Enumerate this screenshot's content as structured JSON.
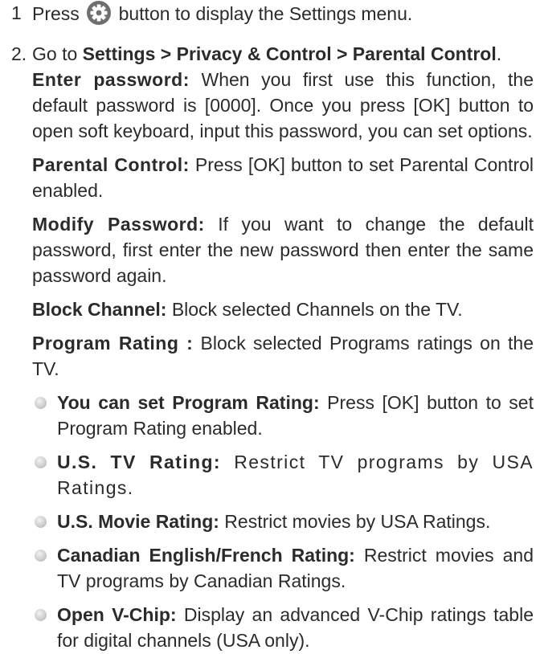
{
  "step1": {
    "number": "1",
    "pre": "Press",
    "icon": "settings-gear-icon",
    "post": "button to display the Settings menu."
  },
  "step2": {
    "number": "2.",
    "goto_pre": "Go to",
    "goto_path": "Settings > Privacy & Control > Parental Control",
    "goto_end": ".",
    "items": [
      {
        "label": "Enter password:",
        "text": "When you first use this function, the default password is [0000]. Once you press [OK] button to open soft keyboard, input this password, you can set options."
      },
      {
        "label": "Parental Control:",
        "text": "Press [OK] button to set Parental Control enabled."
      },
      {
        "label": "Modify Password:",
        "text": "If you want to change the default password, first enter the new password then enter the same password again."
      },
      {
        "label": "Block Channel:",
        "text": "Block selected Channels on the TV."
      },
      {
        "label": "Program Rating :",
        "text": "Block selected Programs ratings on the TV."
      }
    ],
    "bullets": [
      {
        "label": "You can set Program Rating:",
        "text": "Press [OK] button to set Program Rating enabled."
      },
      {
        "label": "U.S. TV Rating:",
        "text": "Restrict TV programs by USA Ratings."
      },
      {
        "label": "U.S. Movie Rating:",
        "text": "Restrict movies by USA Ratings."
      },
      {
        "label": "Canadian English/French Rating:",
        "text": "Restrict movies and TV programs by Canadian Ratings."
      },
      {
        "label": "Open V-Chip:",
        "text": "Display an advanced V-Chip ratings table for digital channels (USA only)."
      }
    ]
  },
  "colors": {
    "text": "#2b2b2b",
    "icon_bg": "#6f6f6f",
    "bullet": "#bdbdbd"
  }
}
